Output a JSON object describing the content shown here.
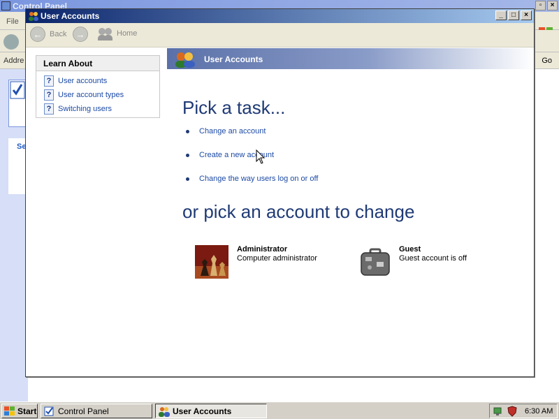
{
  "background_window": {
    "title": "Control Panel",
    "menu_file": "File",
    "address_label": "Addre",
    "go_label": "Go",
    "side_label": "Se"
  },
  "window": {
    "title": "User Accounts",
    "controls": {
      "minimize": "_",
      "maximize": "□",
      "close": "×"
    }
  },
  "nav": {
    "back": "Back",
    "forward": "",
    "home": "Home"
  },
  "sidebar": {
    "header": "Learn About",
    "items": [
      {
        "label": "User accounts",
        "icon": "help-icon"
      },
      {
        "label": "User account types",
        "icon": "help-icon"
      },
      {
        "label": "Switching users",
        "icon": "help-icon"
      }
    ]
  },
  "banner": {
    "title": "User Accounts"
  },
  "main": {
    "pick_task_heading": "Pick a task...",
    "tasks": [
      {
        "label": "Change an account"
      },
      {
        "label": "Create a new account"
      },
      {
        "label": "Change the way users log on or off"
      }
    ],
    "pick_account_heading": "or pick an account to change",
    "accounts": [
      {
        "name": "Administrator",
        "description": "Computer administrator",
        "picture": "chess-picture"
      },
      {
        "name": "Guest",
        "description": "Guest account is off",
        "picture": "suitcase-picture"
      }
    ]
  },
  "taskbar": {
    "start": "Start",
    "buttons": [
      {
        "label": "Control Panel",
        "active": false
      },
      {
        "label": "User Accounts",
        "active": true
      }
    ],
    "clock": "6:30 AM"
  },
  "colors": {
    "heading": "#1f3a75",
    "link": "#1c4aa5",
    "titlebar_start": "#0a246a",
    "titlebar_end": "#a6caf0"
  }
}
